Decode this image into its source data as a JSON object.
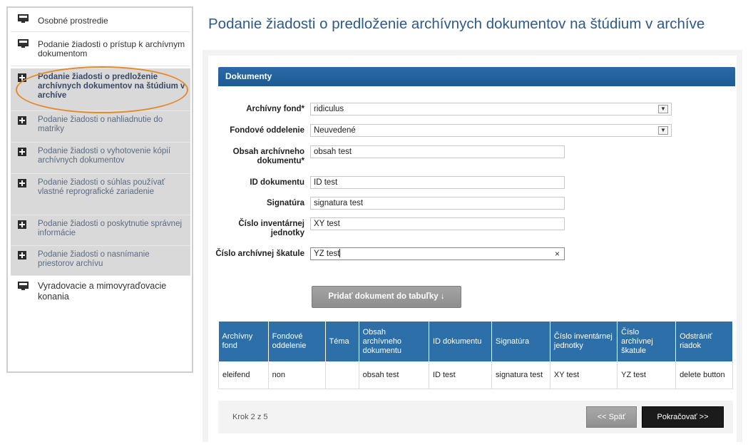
{
  "sidebar": {
    "items": [
      {
        "label": "Osobné prostredie",
        "icon": "monitor-icon"
      },
      {
        "label": "Podanie žiadosti o prístup k archívnym dokumentom",
        "icon": "monitor-icon"
      },
      {
        "label": "Podanie žiadosti o predloženie archívnych dokumentov na štúdium v archíve",
        "icon": "plus-icon",
        "active": true
      },
      {
        "label": "Podanie žiadosti o nahliadnutie do matriky",
        "icon": "plus-icon"
      },
      {
        "label": "Podanie žiadosti o vyhotovenie kópií archívnych dokumentov",
        "icon": "plus-icon"
      },
      {
        "label": "Podanie žiadosti o súhlas používať vlastné reprografické zariadenie",
        "icon": "plus-icon"
      },
      {
        "label": "Podanie žiadosti o poskytnutie správnej informácie",
        "icon": "plus-icon"
      },
      {
        "label": "Podanie žiadosti o nasnímanie priestorov archívu",
        "icon": "plus-icon"
      },
      {
        "label": "Vyradovacie a mimovyraďovacie konania",
        "icon": "monitor-icon"
      }
    ]
  },
  "page": {
    "title": "Podanie žiadosti o predloženie archívnych dokumentov na štúdium v archíve"
  },
  "documents": {
    "header": "Dokumenty",
    "form": {
      "archivny_fond": {
        "label": "Archívny fond*",
        "value": "ridiculus"
      },
      "fondove_oddelenie": {
        "label": "Fondové oddelenie",
        "value": "Neuvedené"
      },
      "obsah": {
        "label": "Obsah archívneho dokumentu*",
        "value": "obsah test"
      },
      "id_dokumentu": {
        "label": "ID dokumentu",
        "value": "ID test"
      },
      "signatura": {
        "label": "Signatúra",
        "value": "signatura test"
      },
      "cislo_inventarnej": {
        "label": "Číslo inventárnej jednotky",
        "value": "XY test"
      },
      "cislo_archivnej": {
        "label": "Číslo archívnej škatule",
        "value": "YZ test"
      }
    },
    "add_button": "Pridať dokument do tabuľky ↓",
    "table": {
      "headers": [
        "Archívny fond",
        "Fondové oddelenie",
        "Téma",
        "Obsah archívneho dokumentu",
        "ID dokumentu",
        "Signatúra",
        "Číslo inventárnej jednotky",
        "Číslo archívnej škatule",
        "Odstrániť riadok"
      ],
      "rows": [
        [
          "eleifend",
          "non",
          "",
          "obsah test",
          "ID test",
          "signatura test",
          "XY test",
          "YZ test",
          "delete button"
        ]
      ]
    }
  },
  "footer": {
    "step": "Krok 2 z 5",
    "back": "<< Späť",
    "next": "Pokračovať >>"
  },
  "colors": {
    "accent": "#2d6fa9",
    "title": "#2d5a8b",
    "highlight": "#e48a2c"
  }
}
